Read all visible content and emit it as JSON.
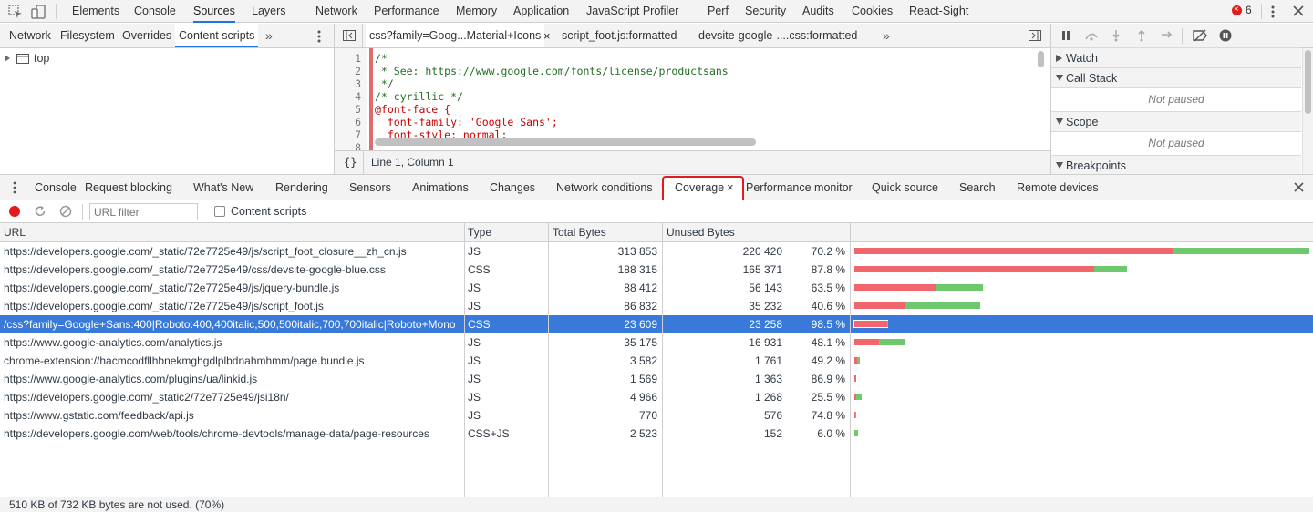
{
  "top_tabs": [
    "Elements",
    "Console",
    "Sources",
    "Layers",
    "Network",
    "Performance",
    "Memory",
    "Application",
    "JavaScript Profiler",
    "Perf",
    "Security",
    "Audits",
    "Cookies",
    "React-Sight"
  ],
  "active_top_tab": "Sources",
  "error_count": "6",
  "navigator_tabs": [
    "Network",
    "Filesystem",
    "Overrides",
    "Content scripts"
  ],
  "navigator_tree_root": "top",
  "editor_tabs": [
    "css?family=Goog...Material+Icons",
    "script_foot.js:formatted",
    "devsite-google-....css:formatted"
  ],
  "code_lines": [
    {
      "n": "1",
      "text": "/*"
    },
    {
      "n": "2",
      "text": " * See: https://www.google.com/fonts/license/productsans"
    },
    {
      "n": "3",
      "text": " */"
    },
    {
      "n": "4",
      "text": "/* cyrillic */"
    },
    {
      "n": "5",
      "text": "@font-face {"
    },
    {
      "n": "6",
      "text": "  font-family: 'Google Sans';"
    },
    {
      "n": "7",
      "text": "  font-style: normal;"
    },
    {
      "n": "8",
      "text": ""
    }
  ],
  "status_position": "Line 1, Column 1",
  "status_braces": "{}",
  "debugger": {
    "watch": "Watch",
    "call_stack": "Call Stack",
    "not_paused_1": "Not paused",
    "scope": "Scope",
    "not_paused_2": "Not paused",
    "breakpoints": "Breakpoints"
  },
  "drawer_tabs": [
    "Console",
    "Request blocking",
    "What's New",
    "Rendering",
    "Sensors",
    "Animations",
    "Changes",
    "Network conditions",
    "Coverage",
    "Performance monitor",
    "Quick source",
    "Search",
    "Remote devices"
  ],
  "active_drawer_tab": "Coverage",
  "coverage_toolbar": {
    "url_filter_placeholder": "URL filter",
    "content_scripts_label": "Content scripts"
  },
  "table_headers": {
    "url": "URL",
    "type": "Type",
    "total": "Total Bytes",
    "unused": "Unused Bytes"
  },
  "rows": [
    {
      "url": "https://developers.google.com/_static/72e7725e49/js/script_foot_closure__zh_cn.js",
      "type": "JS",
      "total": "313 853",
      "unused": "220 420",
      "pct": "70.2 %",
      "used_frac": 0.298,
      "total_frac": 1.0
    },
    {
      "url": "https://developers.google.com/_static/72e7725e49/css/devsite-google-blue.css",
      "type": "CSS",
      "total": "188 315",
      "unused": "165 371",
      "pct": "87.8 %",
      "used_frac": 0.122,
      "total_frac": 0.6
    },
    {
      "url": "https://developers.google.com/_static/72e7725e49/js/jquery-bundle.js",
      "type": "JS",
      "total": "88 412",
      "unused": "56 143",
      "pct": "63.5 %",
      "used_frac": 0.365,
      "total_frac": 0.282
    },
    {
      "url": "https://developers.google.com/_static/72e7725e49/js/script_foot.js",
      "type": "JS",
      "total": "86 832",
      "unused": "35 232",
      "pct": "40.6 %",
      "used_frac": 0.594,
      "total_frac": 0.277
    },
    {
      "url": "/css?family=Google+Sans:400|Roboto:400,400italic,500,500italic,700,700italic|Roboto+Mono",
      "type": "CSS",
      "total": "23 609",
      "unused": "23 258",
      "pct": "98.5 %",
      "used_frac": 0.015,
      "total_frac": 0.075,
      "selected": true
    },
    {
      "url": "https://www.google-analytics.com/analytics.js",
      "type": "JS",
      "total": "35 175",
      "unused": "16 931",
      "pct": "48.1 %",
      "used_frac": 0.519,
      "total_frac": 0.112
    },
    {
      "url": "chrome-extension://hacmcodfllhbnekmghgdlplbdnahmhmm/page.bundle.js",
      "type": "JS",
      "total": "3 582",
      "unused": "1 761",
      "pct": "49.2 %",
      "used_frac": 0.508,
      "total_frac": 0.0114
    },
    {
      "url": "https://www.google-analytics.com/plugins/ua/linkid.js",
      "type": "JS",
      "total": "1 569",
      "unused": "1 363",
      "pct": "86.9 %",
      "used_frac": 0.131,
      "total_frac": 0.005
    },
    {
      "url": "https://developers.google.com/_static2/72e7725e49/jsi18n/",
      "type": "JS",
      "total": "4 966",
      "unused": "1 268",
      "pct": "25.5 %",
      "used_frac": 0.745,
      "total_frac": 0.0158
    },
    {
      "url": "https://www.gstatic.com/feedback/api.js",
      "type": "JS",
      "total": "770",
      "unused": "576",
      "pct": "74.8 %",
      "used_frac": 0.252,
      "total_frac": 0.0025
    },
    {
      "url": "https://developers.google.com/web/tools/chrome-devtools/manage-data/page-resources",
      "type": "CSS+JS",
      "total": "2 523",
      "unused": "152",
      "pct": "6.0 %",
      "used_frac": 0.94,
      "total_frac": 0.008
    }
  ],
  "footer": "510 KB of 732 KB bytes are not used. (70%)",
  "colors": {
    "unused": "#f0666c",
    "used": "#6ec96e",
    "selected_row": "#3879d9",
    "highlight_box": "#e21b1b",
    "accent": "#1a73e8"
  }
}
